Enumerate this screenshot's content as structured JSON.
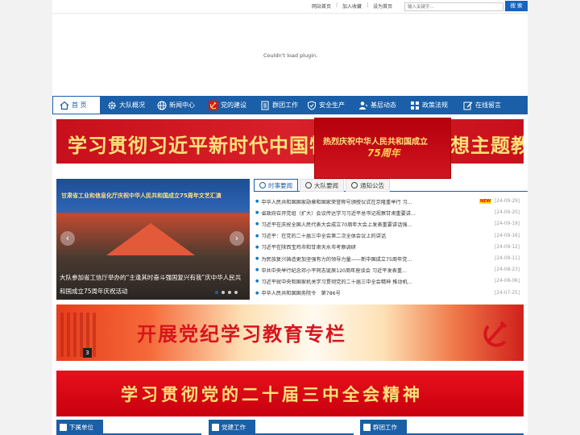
{
  "topbar": {
    "links": [
      "网站首页",
      "加入收藏",
      "设为首页"
    ],
    "search_placeholder": "输入关键字...",
    "search_button": "搜 索"
  },
  "plugin_message": "Couldn't load plugin.",
  "nav": [
    {
      "label": "首 页",
      "icon": "home-icon"
    },
    {
      "label": "大队概况",
      "icon": "gear-icon"
    },
    {
      "label": "新闻中心",
      "icon": "globe-icon"
    },
    {
      "label": "党的建设",
      "icon": "party-emblem-icon"
    },
    {
      "label": "群团工作",
      "icon": "document-icon"
    },
    {
      "label": "安全生产",
      "icon": "shield-check-icon"
    },
    {
      "label": "基层动态",
      "icon": "person-icon"
    },
    {
      "label": "政策法规",
      "icon": "grid-icon"
    },
    {
      "label": "在线留言",
      "icon": "edit-icon"
    }
  ],
  "banner1": {
    "text": "学习贯彻习近平新时代中国特色社会主义思想主题教育"
  },
  "anniversary": {
    "line1": "热烈庆祝中华人民共和国成立",
    "line2": "75周年"
  },
  "slideshow": {
    "header": "甘肃省工业和信息化厅庆祝中华人民共和国成立75周年文艺汇演",
    "caption": "大队参加省工信厅举办的“主逢其时奋斗强国复兴有我”庆中华人民共和国成立75周年庆祝活动"
  },
  "tabs": [
    {
      "label": "时事要闻",
      "active": true
    },
    {
      "label": "大队要闻",
      "active": false
    },
    {
      "label": "通知公告",
      "active": false
    }
  ],
  "news": [
    {
      "title": "中华人民共和国国家勋章和国家荣誉称号颁授仪式在京隆重举行 习...",
      "new": true,
      "date": "[24-09-29]"
    },
    {
      "title": "省政府召开党组（扩大）会议传达学习习近平总书记视察甘肃重要讲...",
      "new": false,
      "date": "[24-09-20]"
    },
    {
      "title": "习近平在庆祝全国人民代表大会成立70周年大会上发表重要讲话强...",
      "new": false,
      "date": "[24-09-19]"
    },
    {
      "title": "习近平：在党的二十届三中全会第二次全体会议上的讲话",
      "new": false,
      "date": "[24-09-16]"
    },
    {
      "title": "习近平在陕西宝鸡市和甘肃天水市考察调研",
      "new": false,
      "date": "[24-09-12]"
    },
    {
      "title": "为民族复兴铸造更加坚强有力的领导力量——新中国成立75周年党...",
      "new": false,
      "date": "[24-09-11]"
    },
    {
      "title": "中共中央举行纪念邓小平同志诞辰120周年座谈会 习近平发表重...",
      "new": false,
      "date": "[24-08-23]"
    },
    {
      "title": "习近平就中央和国家机关学习贯彻党的二十届三中全会精神 推动机...",
      "new": false,
      "date": "[24-08-06]"
    },
    {
      "title": "中华人民共和国国务院令　第786号",
      "new": false,
      "date": "[24-07-25]"
    }
  ],
  "new_badge": "NEW",
  "banner2": {
    "text": "开展党纪学习教育专栏",
    "slide_number": "3"
  },
  "banner3": {
    "text": "学习贯彻党的二十届三中全会精神"
  },
  "sections": [
    "下属单位",
    "党建工作",
    "群团工作"
  ],
  "colors": {
    "primary": "#1a5fa8",
    "party_red": "#d8141c",
    "gold": "#ffe27a"
  }
}
